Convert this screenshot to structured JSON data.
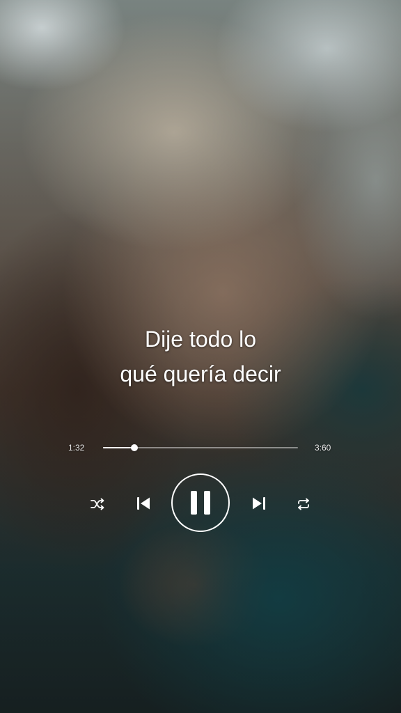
{
  "lyrics": {
    "line1": "Dije todo lo",
    "line2": "qué quería decir"
  },
  "player": {
    "elapsed": "1:32",
    "total": "3:60",
    "progress_fraction": 0.16,
    "is_playing": true
  },
  "icons": {
    "shuffle": "shuffle-icon",
    "previous": "skip-previous-icon",
    "play_pause": "pause-icon",
    "next": "skip-next-icon",
    "repeat": "repeat-icon"
  },
  "colors": {
    "control": "#ffffff",
    "track": "#ffffff"
  }
}
